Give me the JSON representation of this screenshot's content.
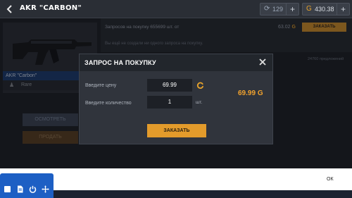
{
  "header": {
    "back_icon": "chevron-left-icon",
    "title": "AKR \"CARBON\"",
    "currency1": {
      "icon": "refresh-coin-icon",
      "value": "129",
      "plus": "+"
    },
    "currency2": {
      "icon": "gold-coin-icon",
      "value": "430.38",
      "plus": "+"
    }
  },
  "item": {
    "name": "AKR \"Carbon\"",
    "rarity": "Rare",
    "rarity_icon": "rarity-icon"
  },
  "actions": {
    "view_label": "ОСМОТРЕТЬ",
    "sell_label": "ПРОДАТЬ"
  },
  "requests": {
    "text": "Запросов на покупку 655699 шт. от",
    "price": "63.02",
    "currency_glyph": "G",
    "button_label": "ЗАКАЗАТЬ",
    "note": "Вы ещё не создали ни одного запроса на покупку.",
    "offers": "24760 предложений"
  },
  "modal": {
    "title": "ЗАПРОС НА ПОКУПКУ",
    "price_label": "Введите цену",
    "price_value": "69.99",
    "qty_label": "Введите количество",
    "qty_value": "1",
    "qty_unit": "шт.",
    "total": "69.99",
    "currency_glyph": "G",
    "order_label": "ЗАКАЗАТЬ"
  },
  "bottom": {
    "ok_label": "ОК"
  },
  "colors": {
    "accent_orange": "#e39b2b",
    "gold": "#e8a32b",
    "rarity_blue": "#1b3d73",
    "dock_blue": "#1d5fc4"
  }
}
